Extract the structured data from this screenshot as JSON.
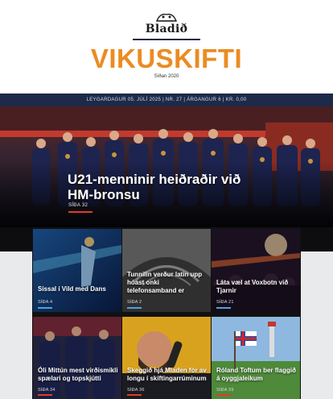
{
  "masthead": {
    "logo_text": "Bladið",
    "title": "VIKUSKIFTI",
    "since": "Síðan 2020"
  },
  "issue_bar": {
    "text": "LEYGARDAGUR 05. JÚLÍ 2025 | NR. 27 | ÁRGANGUR 6 | KR. 0,00"
  },
  "hero": {
    "headline": "U21-menninir heiðraðir við HM-bronsu",
    "page": "SÍÐA 32",
    "accent": "#e23b2e"
  },
  "cards": [
    {
      "title": "Sissal í Vild med Dans",
      "page": "SÍÐA 4",
      "accent": "#4aa3df"
    },
    {
      "title": "Tunnilin verður latin upp hóast onki telefonsamband er",
      "page": "SÍÐA 2",
      "accent": "#4aa3df"
    },
    {
      "title": "Láta væl at Voxbotn við Tjarnir",
      "page": "SÍÐA 21",
      "accent": "#4aa3df"
    },
    {
      "title": "Óli Mittún mest virðismikli spælari og topskjútti",
      "page": "SÍÐA 34",
      "accent": "#e23b2e"
    },
    {
      "title": "Skeggið hjá Mladen fór av longu í skiftingarrúminum",
      "page": "SÍÐA 36",
      "accent": "#e23b2e"
    },
    {
      "title": "Róland Toftum ber flaggið á oyggjaleikum",
      "page": "SÍÐA 39",
      "accent": "#e23b2e"
    }
  ],
  "colors": {
    "brand_orange": "#ec8b22",
    "navy": "#1d2a4a"
  }
}
